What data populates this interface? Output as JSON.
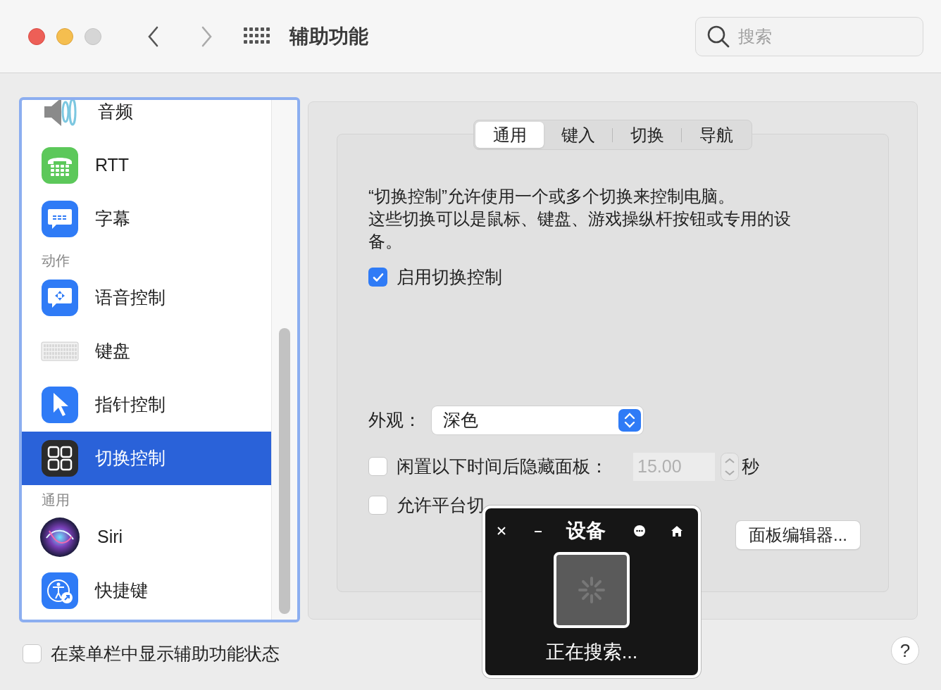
{
  "window": {
    "title": "辅助功能",
    "search": {
      "placeholder": "搜索"
    }
  },
  "sidebar": {
    "items": [
      {
        "kind": "item",
        "label": "音频",
        "selected": false
      },
      {
        "kind": "item",
        "label": "RTT",
        "selected": false
      },
      {
        "kind": "item",
        "label": "字幕",
        "selected": false
      },
      {
        "kind": "header",
        "label": "动作"
      },
      {
        "kind": "item",
        "label": "语音控制",
        "selected": false
      },
      {
        "kind": "item",
        "label": "键盘",
        "selected": false
      },
      {
        "kind": "item",
        "label": "指针控制",
        "selected": false
      },
      {
        "kind": "item",
        "label": "切换控制",
        "selected": true
      },
      {
        "kind": "header",
        "label": "通用"
      },
      {
        "kind": "item",
        "label": "Siri",
        "selected": false
      },
      {
        "kind": "item",
        "label": "快捷键",
        "selected": false
      }
    ]
  },
  "tabs": [
    {
      "label": "通用",
      "selected": true
    },
    {
      "label": "键入",
      "selected": false
    },
    {
      "label": "切换",
      "selected": false
    },
    {
      "label": "导航",
      "selected": false
    }
  ],
  "description": [
    "“切换控制”允许使用一个或多个切换来控制电脑。",
    "这些切换可以是鼠标、键盘、游戏操纵杆按钮或专用的设备。"
  ],
  "enable": {
    "label": "启用切换控制",
    "checked": true
  },
  "appearance": {
    "label": "外观：",
    "value": "深色"
  },
  "hide_panel": {
    "label": "闲置以下时间后隐藏面板：",
    "checked": false,
    "value": "15.00",
    "unit": "秒"
  },
  "allow_platform": {
    "label": "允许平台切",
    "checked": false
  },
  "panel_editor_button": "面板编辑器...",
  "menu_bar_status": {
    "label": "在菜单栏中显示辅助功能状态",
    "checked": false
  },
  "help_button": "?",
  "overlay": {
    "title": "设备",
    "status": "正在搜索..."
  }
}
